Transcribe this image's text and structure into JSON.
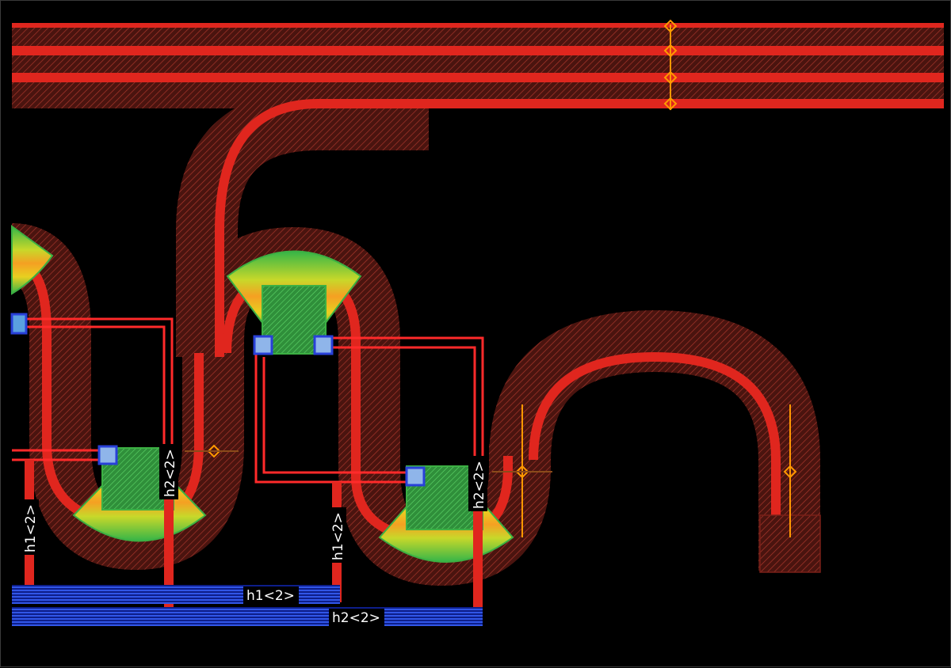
{
  "colors": {
    "background": "#000000",
    "waveguide_core": "#e0261e",
    "waveguide_cladding": "#5a1a14",
    "cladding_hatch": "#b23a2e",
    "metal_bus": "#1d3fe0",
    "heater_green": "#3cb043",
    "heater_orange": "#f59a23",
    "heater_yellow": "#e8d020",
    "via_blue": "#5aa0e0",
    "marker_orange": "#ff9900"
  },
  "labels": {
    "h1_left": "h1<2>",
    "h2_left": "h2<2>",
    "h1_mid": "h1<2>",
    "h2_mid": "h2<2>",
    "bus_h1": "h1<2>",
    "bus_h2": "h2<2>"
  }
}
